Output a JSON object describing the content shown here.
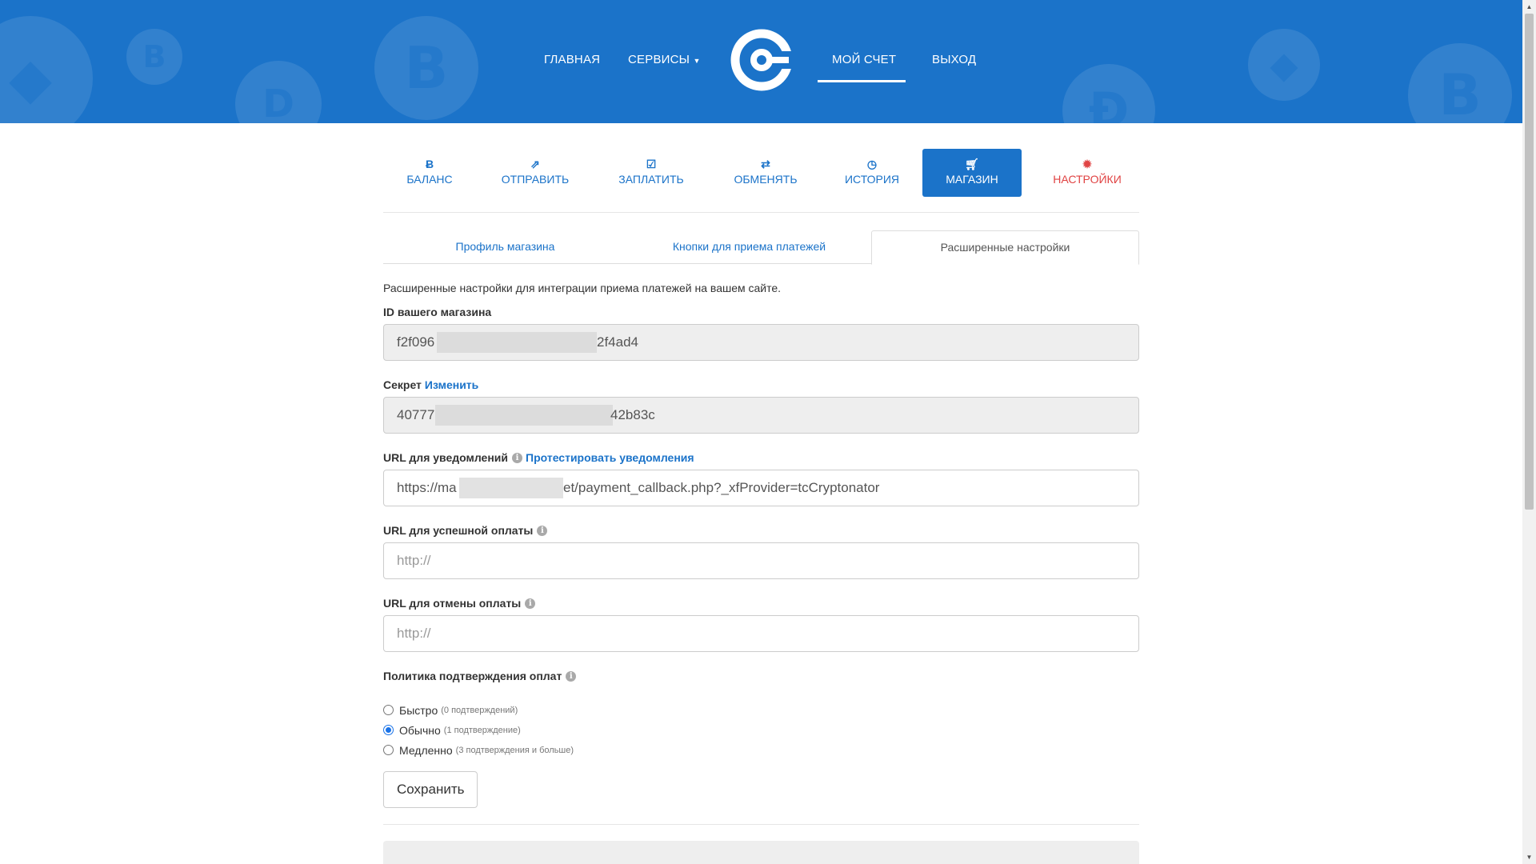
{
  "nav": {
    "home": "ГЛАВНАЯ",
    "services": "СЕРВИСЫ",
    "account": "МОЙ СЧЕТ",
    "logout": "ВЫХОД"
  },
  "tabs": [
    {
      "label": "БАЛАНС",
      "icon": "bitcoin-icon"
    },
    {
      "label": "ОТПРАВИТЬ",
      "icon": "send-icon"
    },
    {
      "label": "ЗАПЛАТИТЬ",
      "icon": "check-icon"
    },
    {
      "label": "ОБМЕНЯТЬ",
      "icon": "exchange-icon"
    },
    {
      "label": "ИСТОРИЯ",
      "icon": "clock-icon"
    },
    {
      "label": "МАГАЗИН",
      "icon": "cart-icon"
    },
    {
      "label": "НАСТРОЙКИ",
      "icon": "gear-icon"
    }
  ],
  "subtabs": [
    "Профиль магазина",
    "Кнопки для приема платежей",
    "Расширенные настройки"
  ],
  "description": "Расширенные настройки для интеграции приема платежей на вашем сайте.",
  "fields": {
    "shop_id": {
      "label": "ID вашего магазина",
      "value_start": "f2f096",
      "value_end": "2f4ad4"
    },
    "secret": {
      "label": "Секрет",
      "link": "Изменить",
      "value_start": "40777",
      "value_end": "42b83c"
    },
    "notify_url": {
      "label": "URL для уведомлений",
      "link": "Протестировать уведомления",
      "value_start": "https://ma",
      "value_end": "et/payment_callback.php?_xfProvider=tcCryptonator"
    },
    "success_url": {
      "label": "URL для успешной оплаты",
      "placeholder": "http://"
    },
    "cancel_url": {
      "label": "URL для отмены оплаты",
      "placeholder": "http://"
    }
  },
  "policy": {
    "label": "Политика подтверждения оплат",
    "options": [
      {
        "label": "Быстро",
        "hint": "(0 подтверждений)",
        "checked": false
      },
      {
        "label": "Обычно",
        "hint": "(1 подтверждение)",
        "checked": true
      },
      {
        "label": "Медленно",
        "hint": "(3 подтверждения и больше)",
        "checked": false
      }
    ]
  },
  "save_label": "Сохранить",
  "colors": {
    "brand": "#1b73c9",
    "danger": "#e04343"
  }
}
